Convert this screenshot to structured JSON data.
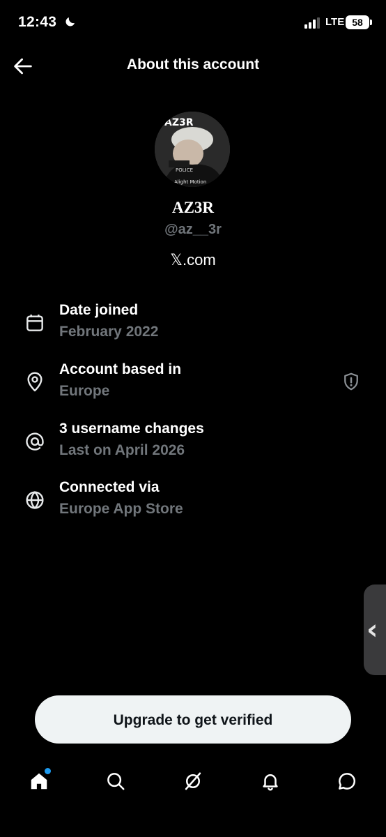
{
  "status_bar": {
    "time": "12:43",
    "network": "LTE",
    "battery": "58",
    "icons": [
      "moon-icon",
      "signal-icon"
    ]
  },
  "header": {
    "title": "About this account",
    "back_icon": "arrow-left-icon"
  },
  "profile": {
    "display_name": "AZ3R",
    "handle": "@az__3r",
    "site": "𝕏.com",
    "avatar_caption": "Alight Motion"
  },
  "info_rows": [
    {
      "icon": "calendar-icon",
      "title": "Date joined",
      "subtitle": "February 2022"
    },
    {
      "icon": "location-pin-icon",
      "title": "Account based in",
      "subtitle": "Europe",
      "action_icon": "shield-alert-icon"
    },
    {
      "icon": "at-sign-icon",
      "title": "3 username changes",
      "subtitle": "Last on April 2026"
    },
    {
      "icon": "globe-icon",
      "title": "Connected via",
      "subtitle": "Europe App Store"
    }
  ],
  "side_handle": {
    "glyph": "‹"
  },
  "cta": {
    "label": "Upgrade to get verified"
  },
  "bottom_nav": {
    "items": [
      "home-icon",
      "search-icon",
      "grok-icon",
      "bell-icon",
      "chat-icon"
    ],
    "active": "home-icon",
    "accent_color": "#1d9bf0"
  },
  "colors": {
    "background": "#000000",
    "primary_text": "#ffffff",
    "secondary_text": "#71767b",
    "button_bg": "#eff3f4"
  }
}
